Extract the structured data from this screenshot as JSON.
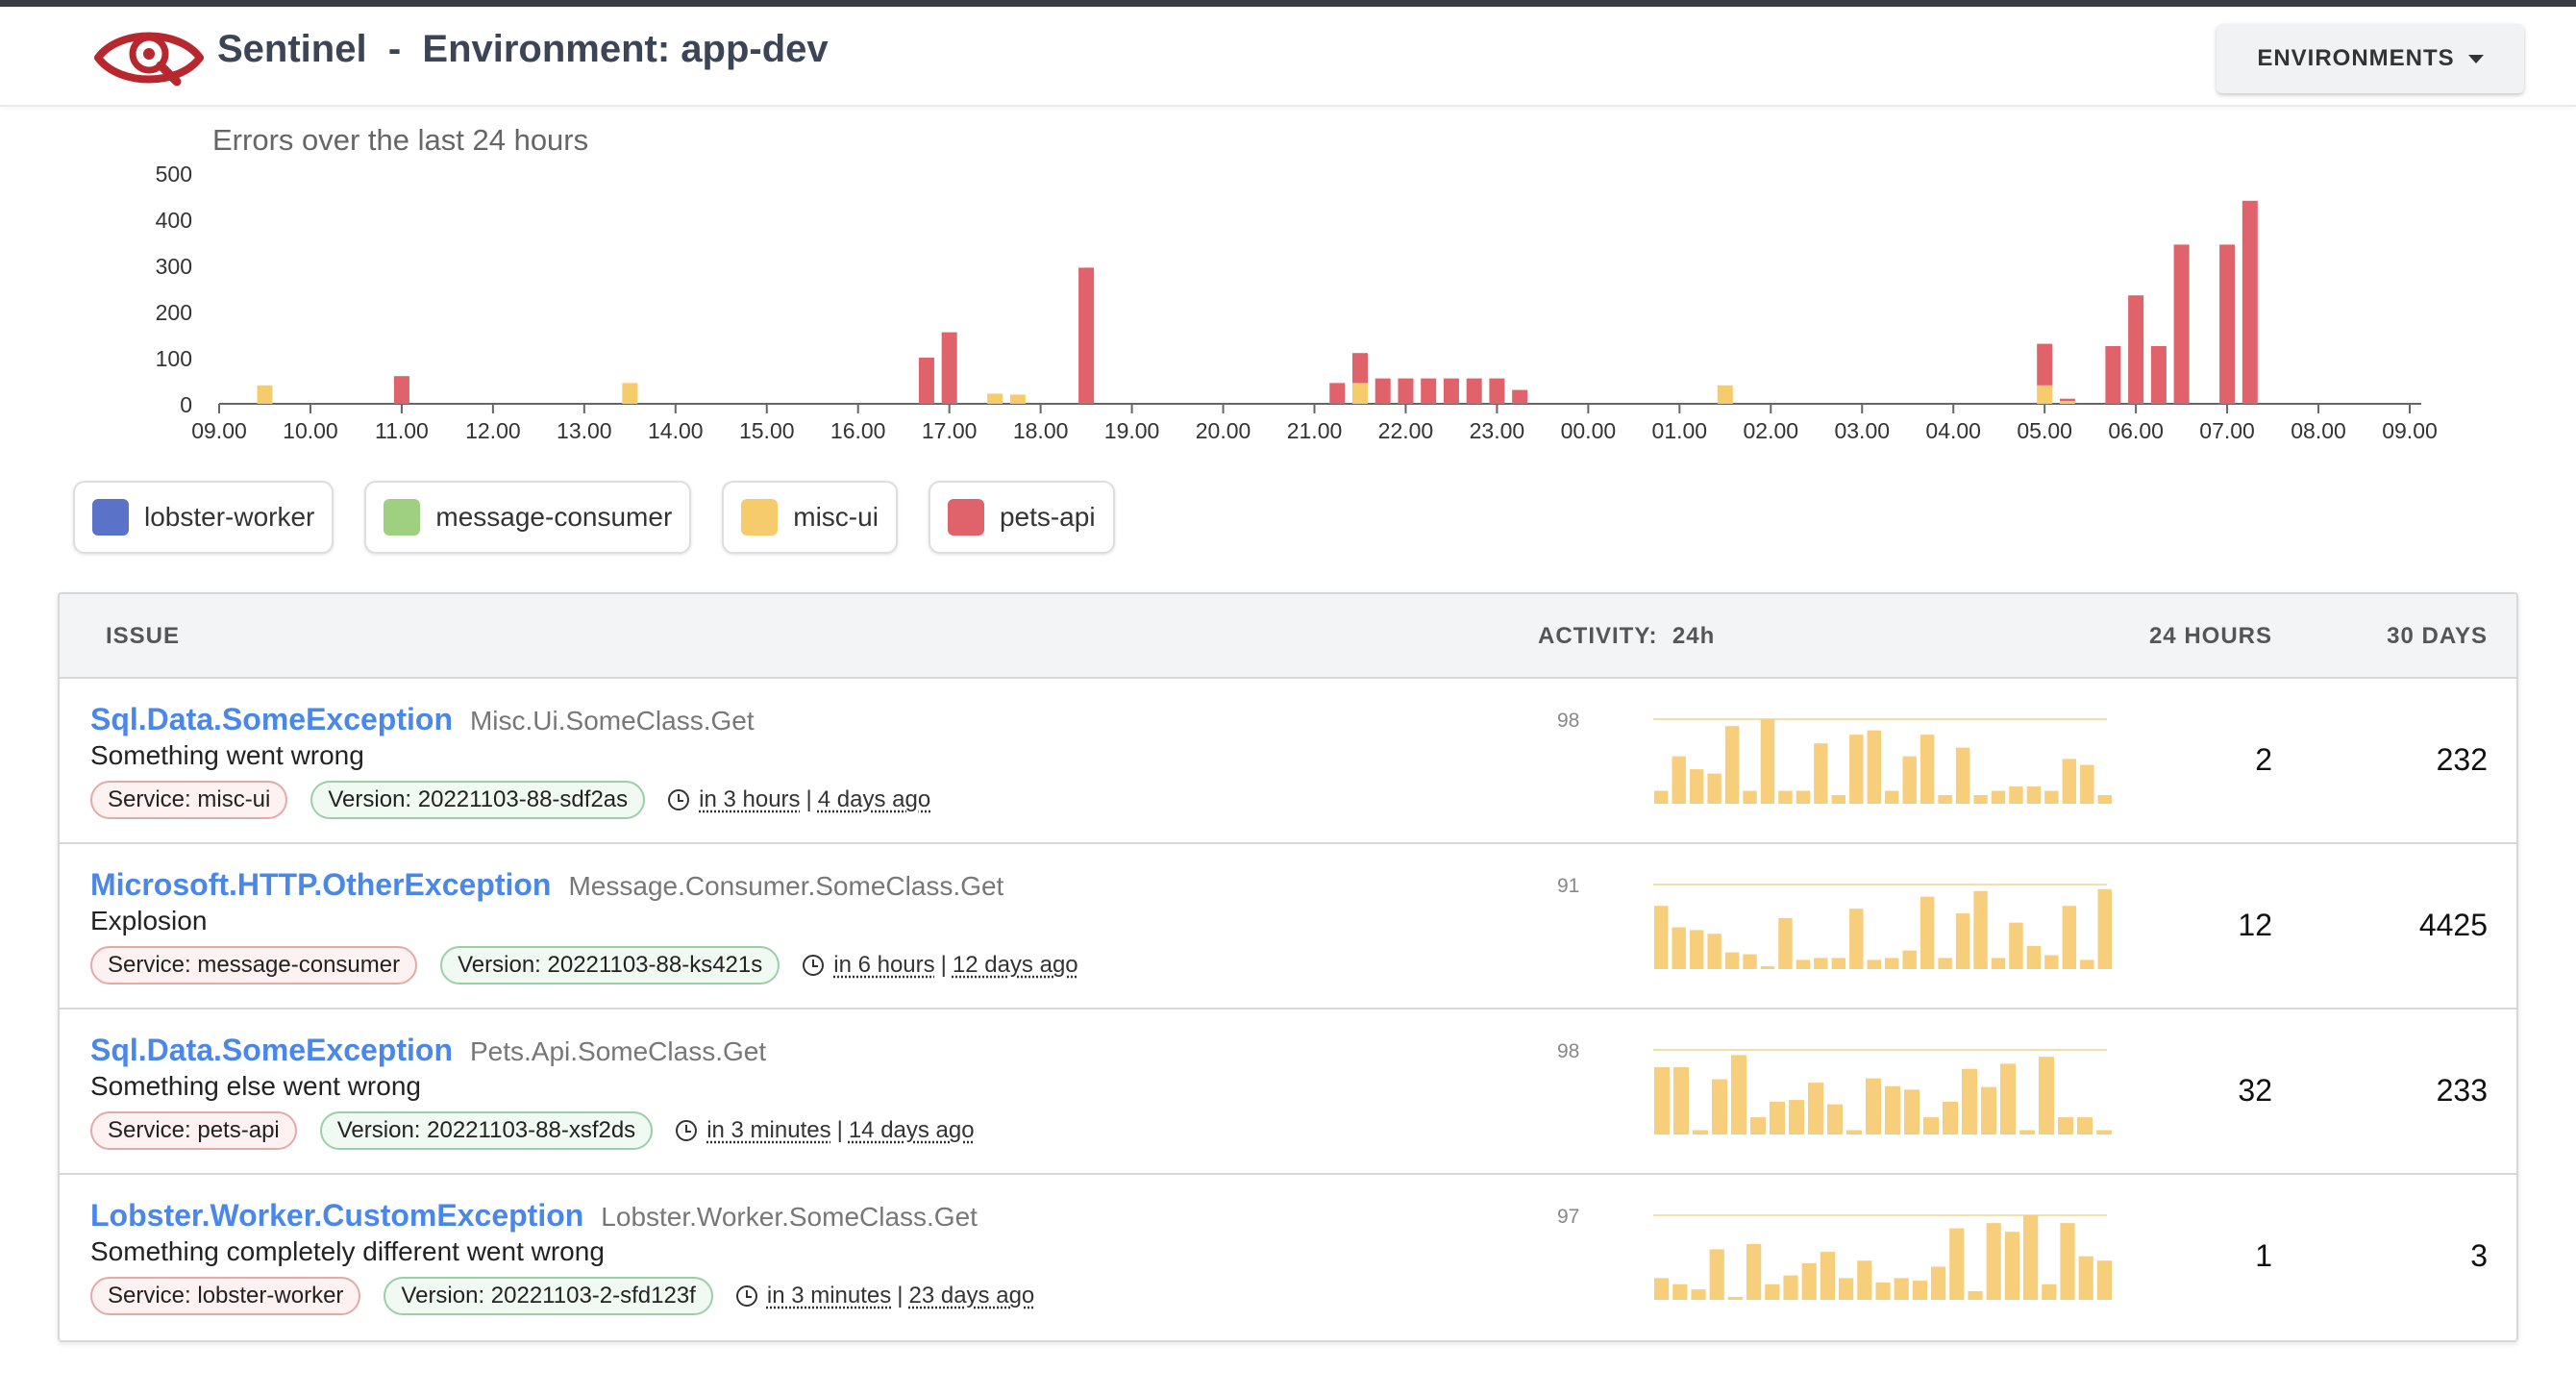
{
  "header": {
    "app_name": "Sentinel",
    "separator": "-",
    "environment_title": "Environment: app-dev",
    "environments_button": "ENVIRONMENTS"
  },
  "colors": {
    "brand": "#b8262e",
    "link": "#4a87e8",
    "lobster_worker": "#5b72c9",
    "message_consumer": "#9fd07f",
    "misc_ui": "#f6cb6c",
    "pets_api": "#e0636b"
  },
  "chart_data": {
    "type": "bar",
    "stacked": true,
    "title": "Errors over the last 24 hours",
    "ylim": [
      0,
      500
    ],
    "yticks": [
      0,
      100,
      200,
      300,
      400,
      500
    ],
    "xticks": [
      "09.00",
      "10.00",
      "11.00",
      "12.00",
      "13.00",
      "14.00",
      "15.00",
      "16.00",
      "17.00",
      "18.00",
      "19.00",
      "20.00",
      "21.00",
      "22.00",
      "23.00",
      "00.00",
      "01.00",
      "02.00",
      "03.00",
      "04.00",
      "05.00",
      "06.00",
      "07.00",
      "08.00",
      "09.00"
    ],
    "x_unit": "hours from 09.00",
    "grid": false,
    "legend_position": "bottom-left",
    "series": [
      {
        "name": "misc-ui",
        "color": "#f6cb6c",
        "points": [
          [
            0.5,
            40
          ],
          [
            4.5,
            45
          ],
          [
            8.5,
            22
          ],
          [
            8.75,
            20
          ],
          [
            12.5,
            45
          ],
          [
            16.5,
            40
          ],
          [
            20,
            40
          ],
          [
            20.25,
            6
          ]
        ]
      },
      {
        "name": "pets-api",
        "color": "#e0636b",
        "points": [
          [
            2,
            60
          ],
          [
            7.75,
            100
          ],
          [
            8,
            155
          ],
          [
            9.5,
            295
          ],
          [
            12.25,
            45
          ],
          [
            12.5,
            65
          ],
          [
            12.75,
            55
          ],
          [
            13,
            55
          ],
          [
            13.25,
            55
          ],
          [
            13.5,
            55
          ],
          [
            13.75,
            55
          ],
          [
            14,
            55
          ],
          [
            14.25,
            30
          ],
          [
            20,
            90
          ],
          [
            20.25,
            5
          ],
          [
            20.75,
            125
          ],
          [
            21,
            235
          ],
          [
            21.25,
            125
          ],
          [
            21.5,
            345
          ],
          [
            22,
            345
          ],
          [
            22.25,
            440
          ]
        ]
      },
      {
        "name": "lobster-worker",
        "color": "#5b72c9",
        "points": []
      },
      {
        "name": "message-consumer",
        "color": "#9fd07f",
        "points": []
      }
    ]
  },
  "legend": [
    {
      "label": "lobster-worker",
      "color": "#5b72c9"
    },
    {
      "label": "message-consumer",
      "color": "#9fd07f"
    },
    {
      "label": "misc-ui",
      "color": "#f6cb6c"
    },
    {
      "label": "pets-api",
      "color": "#e0636b"
    }
  ],
  "table": {
    "col_issue": "ISSUE",
    "col_activity": "ACTIVITY:  24h",
    "col_24h": "24 HOURS",
    "col_30d": "30 DAYS"
  },
  "issues": [
    {
      "exception": "Sql.Data.SomeException",
      "location": "Misc.Ui.SomeClass.Get",
      "message": "Something went wrong",
      "service": "Service: misc-ui",
      "version": "Version: 20221103-88-sdf2as",
      "time_next": "in 3 hours",
      "time_sep": "|",
      "time_first": "4 days ago",
      "activity_max": "98",
      "activity": [
        15,
        55,
        40,
        35,
        90,
        15,
        98,
        15,
        15,
        70,
        10,
        80,
        85,
        15,
        55,
        80,
        10,
        65,
        10,
        15,
        20,
        20,
        15,
        52,
        45,
        10
      ],
      "count_24h": "2",
      "count_30d": "232"
    },
    {
      "exception": "Microsoft.HTTP.OtherException",
      "location": "Message.Consumer.SomeClass.Get",
      "message": "Explosion",
      "service": "Service: message-consumer",
      "version": "Version: 20221103-88-ks421s",
      "time_next": "in 6 hours",
      "time_sep": "|",
      "time_first": "12 days ago",
      "activity_max": "91",
      "activity": [
        68,
        45,
        42,
        38,
        18,
        16,
        2,
        55,
        10,
        12,
        12,
        65,
        10,
        12,
        20,
        78,
        12,
        60,
        84,
        12,
        50,
        25,
        15,
        68,
        10,
        86
      ],
      "count_24h": "12",
      "count_30d": "4425"
    },
    {
      "exception": "Sql.Data.SomeException",
      "location": "Pets.Api.SomeClass.Get",
      "message": "Something else went wrong",
      "service": "Service: pets-api",
      "version": "Version: 20221103-88-xsf2ds",
      "time_next": "in 3 minutes",
      "time_sep": "|",
      "time_first": "14 days ago",
      "activity_max": "98",
      "activity": [
        78,
        78,
        5,
        64,
        92,
        20,
        38,
        40,
        60,
        35,
        5,
        65,
        56,
        52,
        20,
        38,
        76,
        55,
        82,
        5,
        90,
        20,
        20,
        5
      ],
      "count_24h": "32",
      "count_30d": "233"
    },
    {
      "exception": "Lobster.Worker.CustomException",
      "location": "Lobster.Worker.SomeClass.Get",
      "message": "Something completely different went wrong",
      "service": "Service: lobster-worker",
      "version": "Version: 20221103-2-sfd123f",
      "time_next": "in 3 minutes",
      "time_sep": "|",
      "time_first": "23 days ago",
      "activity_max": "97",
      "activity": [
        25,
        18,
        12,
        58,
        2,
        64,
        18,
        28,
        42,
        55,
        25,
        45,
        20,
        25,
        22,
        38,
        82,
        10,
        88,
        78,
        97,
        18,
        88,
        50,
        45
      ],
      "count_24h": "1",
      "count_30d": "3"
    }
  ]
}
